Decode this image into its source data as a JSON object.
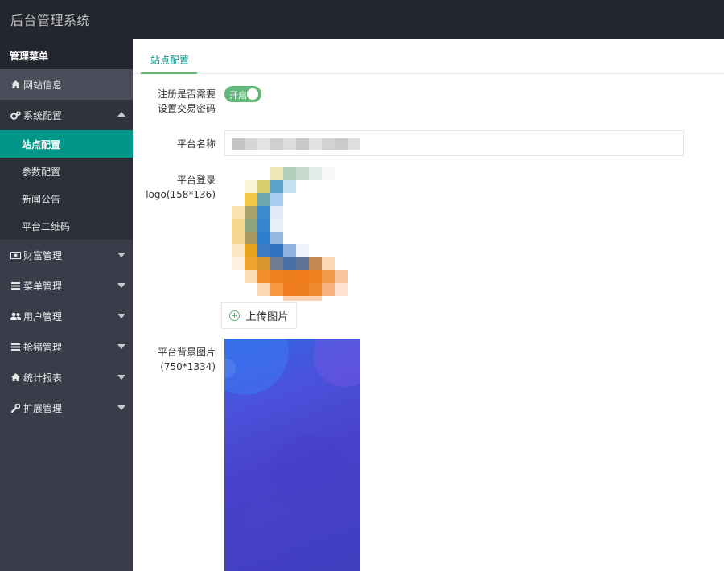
{
  "app": {
    "title": "后台管理系统"
  },
  "sidebar": {
    "header": "管理菜单",
    "items": [
      {
        "label": "网站信息",
        "icon": "home-icon"
      },
      {
        "label": "系统配置",
        "icon": "gears-icon",
        "expanded": true,
        "children": [
          {
            "label": "站点配置",
            "active": true
          },
          {
            "label": "参数配置"
          },
          {
            "label": "新闻公告"
          },
          {
            "label": "平台二维码"
          }
        ]
      },
      {
        "label": "财富管理",
        "icon": "money-icon"
      },
      {
        "label": "菜单管理",
        "icon": "list-icon"
      },
      {
        "label": "用户管理",
        "icon": "users-icon"
      },
      {
        "label": "抢猪管理",
        "icon": "list-icon"
      },
      {
        "label": "统计报表",
        "icon": "home-icon"
      },
      {
        "label": "扩展管理",
        "icon": "wrench-icon"
      }
    ]
  },
  "tabs": [
    {
      "label": "站点配置",
      "active": true
    }
  ],
  "form": {
    "trade_password": {
      "label_line1": "注册是否需要",
      "label_line2": "设置交易密码",
      "toggle_text": "开启",
      "on": true
    },
    "platform_name": {
      "label": "平台名称",
      "value": ""
    },
    "platform_logo": {
      "label_line1": "平台登录",
      "label_line2": "logo(158*136)",
      "upload_label": "上传图片"
    },
    "platform_bg": {
      "label_line1": "平台背景图片",
      "label_line2": "(750*1334)"
    }
  },
  "colors": {
    "accent": "#009688",
    "green": "#5FB878",
    "header": "#23262e",
    "sidebar": "#393d49"
  }
}
